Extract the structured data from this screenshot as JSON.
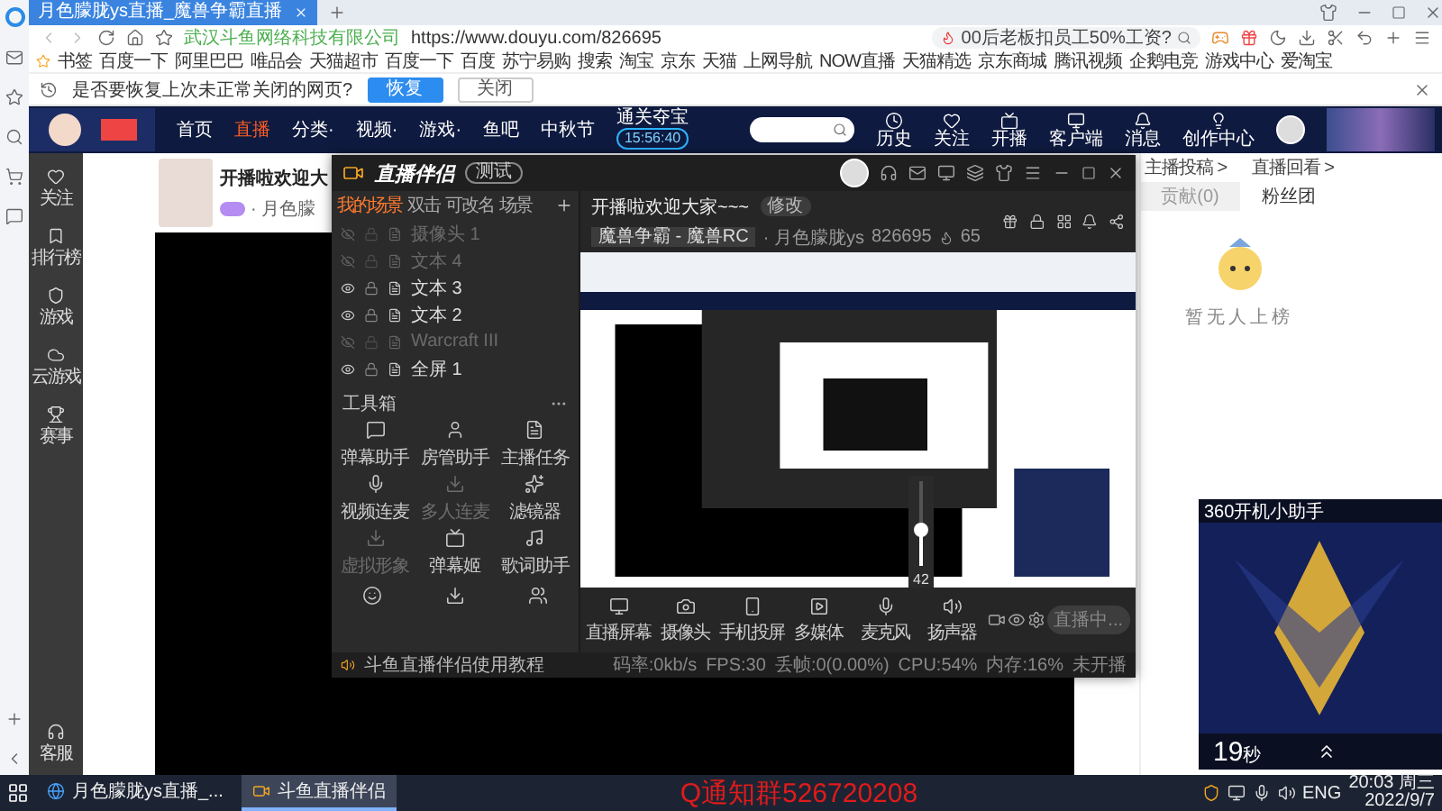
{
  "browser": {
    "tab_title": "月色朦胧ys直播_魔兽争霸直播",
    "site_name": "武汉斗鱼网络科技有限公司",
    "url": "https://www.douyu.com/826695",
    "search": "00后老板扣员工50%工资?"
  },
  "bookmarks": [
    "书签",
    "百度一下",
    "阿里巴巴",
    "唯品会",
    "天猫超市",
    "百度一下",
    "百度",
    "苏宁易购",
    "搜索",
    "淘宝",
    "京东",
    "天猫",
    "上网导航",
    "NOW直播",
    "天猫精选",
    "京东商城",
    "腾讯视频",
    "企鹅电竞",
    "游戏中心",
    "爱淘宝"
  ],
  "restore_bar": {
    "message": "是否要恢复上次未正常关闭的网页?",
    "buttons": [
      {
        "label": "恢复",
        "kind": "primary"
      },
      {
        "label": "关闭",
        "kind": "secondary"
      }
    ]
  },
  "site_header": {
    "nav": [
      {
        "label": "首页",
        "selected": false
      },
      {
        "label": "直播",
        "selected": true
      },
      {
        "label": "分类·",
        "selected": false
      },
      {
        "label": "视频·",
        "selected": false
      },
      {
        "label": "游戏·",
        "selected": false
      },
      {
        "label": "鱼吧",
        "selected": false
      },
      {
        "label": "中秋节",
        "selected": false
      }
    ],
    "promo": {
      "title": "通关夺宝",
      "timer": "15:56:40"
    },
    "actions": [
      "历史",
      "关注",
      "开播",
      "客户端",
      "消息",
      "创作中心"
    ]
  },
  "site_sidebar": [
    "关注",
    "排行榜",
    "游戏",
    "云游戏",
    "赛事",
    "客服"
  ],
  "room": {
    "title": "开播啦欢迎大",
    "streamer": "· 月色朦"
  },
  "side_panel": {
    "links": [
      "主播投稿 >",
      "直播回看 >"
    ],
    "tabs": [
      {
        "label": "贡献(0)",
        "selected": false
      },
      {
        "label": "粉丝团",
        "selected": true
      }
    ],
    "empty_text": "暂无人上榜"
  },
  "app": {
    "title": "直播伴侣",
    "badge": "测试",
    "scene_tabs": [
      {
        "label": "我的场景",
        "selected": true
      },
      {
        "label": "双击",
        "selected": false
      },
      {
        "label": "可改名",
        "selected": false
      },
      {
        "label": "场景",
        "selected": false
      }
    ],
    "sources": [
      {
        "label": "摄像头 1",
        "visible": false
      },
      {
        "label": "文本 4",
        "visible": false
      },
      {
        "label": "文本 3",
        "visible": true
      },
      {
        "label": "文本 2",
        "visible": true
      },
      {
        "label": "Warcraft III",
        "visible": false
      },
      {
        "label": "全屏 1",
        "visible": true
      }
    ],
    "toolbox_title": "工具箱",
    "tools": [
      {
        "label": "弹幕助手",
        "disabled": false
      },
      {
        "label": "房管助手",
        "disabled": false
      },
      {
        "label": "主播任务",
        "disabled": false
      },
      {
        "label": "视频连麦",
        "disabled": false
      },
      {
        "label": "多人连麦",
        "disabled": true
      },
      {
        "label": "滤镜器",
        "disabled": false
      },
      {
        "label": "虚拟形象",
        "disabled": true
      },
      {
        "label": "弹幕姬",
        "disabled": false
      },
      {
        "label": "歌词助手",
        "disabled": false
      }
    ],
    "stream": {
      "title": "开播啦欢迎大家~~~",
      "edit": "修改",
      "category": "魔兽争霸 - 魔兽RC",
      "streamer": "· 月色朦胧ys",
      "room_id": "826695",
      "heat": "65"
    },
    "controls": [
      "直播屏幕",
      "摄像头",
      "手机投屏",
      "多媒体",
      "麦克风",
      "扬声器"
    ],
    "volume": {
      "level": 0.42,
      "reading": "42"
    },
    "live_button": "直播中...",
    "status": {
      "tutorial": "斗鱼直播伴侣使用教程",
      "metrics": [
        "码率:0kb/s",
        "FPS:30",
        "丢帧:0(0.00%)",
        "CPU:54%",
        "内存:16%"
      ],
      "state": "未开播"
    }
  },
  "ad": {
    "title": "360开机小助手",
    "countdown": "19",
    "unit": "秒"
  },
  "taskbar": {
    "items": [
      {
        "label": "月色朦胧ys直播_...",
        "selected": false
      },
      {
        "label": "斗鱼直播伴侣",
        "selected": true
      }
    ],
    "notice": "Q通知群526720208",
    "language": "ENG",
    "time": "20:03 周三",
    "date": "2022/9/7"
  }
}
